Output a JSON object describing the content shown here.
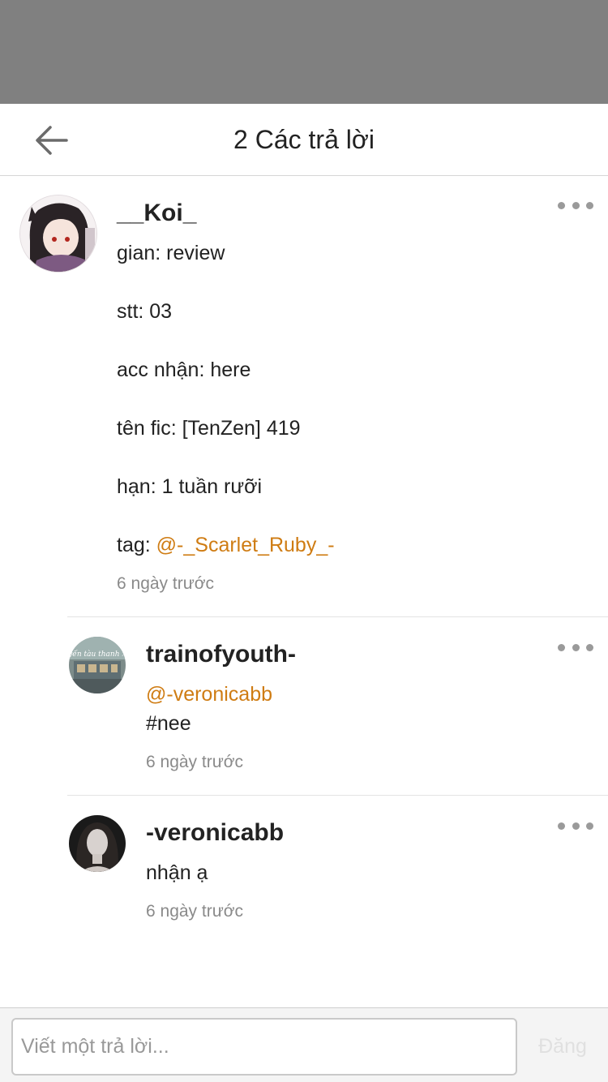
{
  "header": {
    "title": "2 Các trả lời"
  },
  "main_comment": {
    "username": "__Koi_",
    "lines": [
      "gian: review",
      "stt: 03",
      "acc nhận: here",
      "tên fic: [TenZen] 419",
      "hạn: 1 tuần rưỡi"
    ],
    "tag_prefix": "tag: ",
    "tag_mention": "@-_Scarlet_Ruby_-",
    "timestamp": "6 ngày trước"
  },
  "replies": [
    {
      "username": "trainofyouth-",
      "mention": "@-veronicabb",
      "text": "#nee",
      "timestamp": "6 ngày trước",
      "avatar_text": "chuyến tàu thanh xuân"
    },
    {
      "username": "-veronicabb",
      "text": "nhận ạ",
      "timestamp": "6 ngày trước"
    }
  ],
  "footer": {
    "placeholder": "Viết một trả lời...",
    "post_label": "Đăng"
  },
  "colors": {
    "mention": "#cf7c13",
    "overlay": "#808080",
    "timestamp": "#8a8a8a"
  }
}
